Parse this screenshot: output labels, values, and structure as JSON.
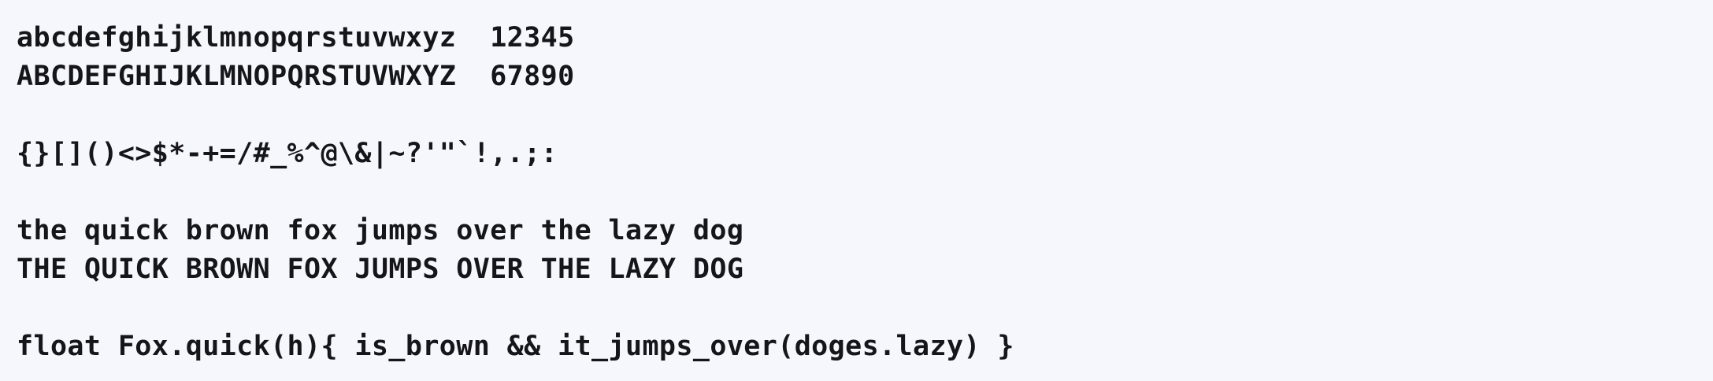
{
  "specimen": {
    "lowercase": "abcdefghijklmnopqrstuvwxyz  12345",
    "uppercase": "ABCDEFGHIJKLMNOPQRSTUVWXYZ  67890",
    "symbols": "{}[]()<>$*-+=/#_%^@\\&|~?'\"`!,.;:",
    "pangram_lower": "the quick brown fox jumps over the lazy dog",
    "pangram_upper": "THE QUICK BROWN FOX JUMPS OVER THE LAZY DOG",
    "code_sample": "float Fox.quick(h){ is_brown && it_jumps_over(doges.lazy) }"
  },
  "colors": {
    "background": "#f6f7fd",
    "text": "#16161a"
  }
}
